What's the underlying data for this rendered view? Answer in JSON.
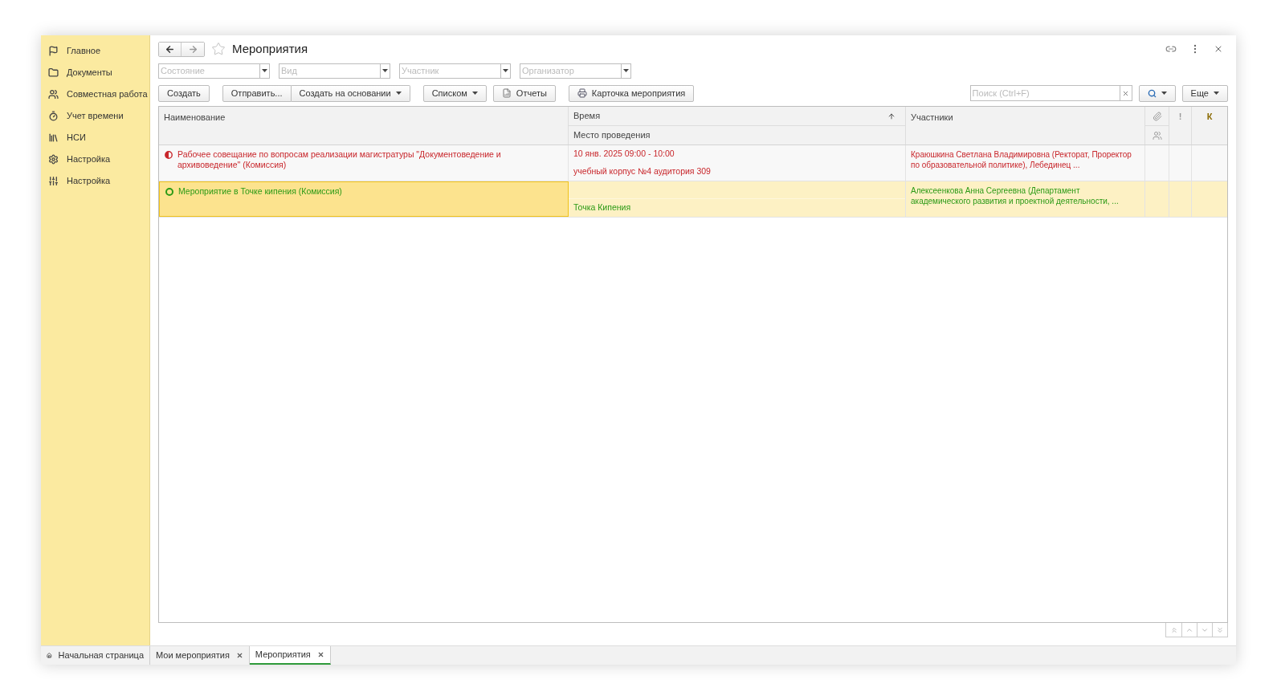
{
  "sidebar": {
    "items": [
      {
        "label": "Главное"
      },
      {
        "label": "Документы"
      },
      {
        "label": "Совместная работа"
      },
      {
        "label": "Учет времени"
      },
      {
        "label": "НСИ"
      },
      {
        "label": "Настройка"
      },
      {
        "label": "Настройка"
      }
    ]
  },
  "header": {
    "title": "Мероприятия",
    "favorite": false
  },
  "filters": [
    {
      "placeholder": "Состояние"
    },
    {
      "placeholder": "Вид"
    },
    {
      "placeholder": "Участник"
    },
    {
      "placeholder": "Организатор"
    }
  ],
  "toolbar": {
    "create": "Создать",
    "send": "Отправить...",
    "based_on": "Создать на основании",
    "list": "Списком",
    "reports": "Отчеты",
    "card": "Карточка мероприятия",
    "search_placeholder": "Поиск (Ctrl+F)",
    "more": "Еще"
  },
  "table": {
    "columns": {
      "name": "Наименование",
      "time": "Время",
      "place": "Место проведения",
      "participants": "Участники",
      "flag": "!",
      "k": "К"
    },
    "rows": [
      {
        "kind": "in_progress",
        "color": "#c8262b",
        "selected": false,
        "name": "Рабочее совещание по вопросам реализации магистратуры \"Документоведение и архивоведение\" (Комиссия)",
        "time": "10 янв. 2025 09:00 - 10:00",
        "place": "учебный корпус №4 аудитория 309",
        "participants": "Краюшкина Светлана Владимировна (Ректорат, Проректор по образовательной политике), Лебединец ..."
      },
      {
        "kind": "planned",
        "color": "#2b9a16",
        "selected": true,
        "name": "Мероприятие в Точке кипения (Комиссия)",
        "place": "Точка Кипения",
        "participants": "Алексеенкова Анна Сергеевна (Департамент академического развития и проектной деятельности, ..."
      }
    ]
  },
  "tabs": [
    {
      "label": "Начальная страница",
      "kind": "home",
      "selected": false
    },
    {
      "label": "Мои мероприятия",
      "kind": "closable",
      "selected": false
    },
    {
      "label": "Мероприятия",
      "kind": "closable",
      "selected": true
    }
  ]
}
